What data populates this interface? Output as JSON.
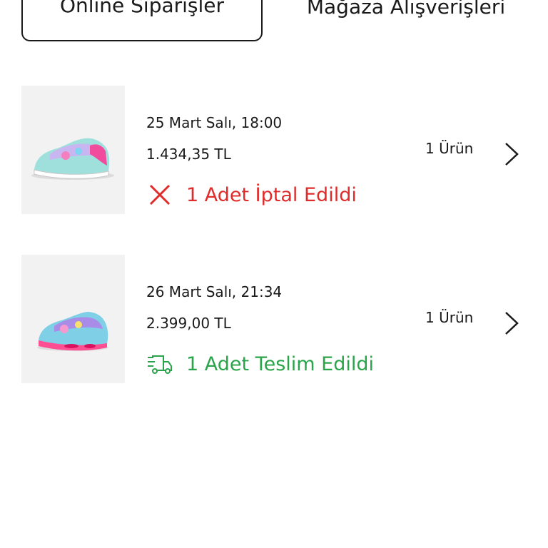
{
  "tabs": [
    {
      "label": "Online Siparişler",
      "active": true
    },
    {
      "label": "Mağaza Alışverişleri",
      "active": false
    }
  ],
  "orders": [
    {
      "date": "25 Mart Salı, 18:00",
      "price": "1.434,35 TL",
      "count": "1 Ürün",
      "status": "1 Adet İptal Edildi",
      "status_icon": "close-icon",
      "status_color": "#e02b2b"
    },
    {
      "date": "26 Mart Salı, 21:34",
      "price": "2.399,00 TL",
      "count": "1 Ürün",
      "status": "1 Adet Teslim Edildi",
      "status_icon": "delivery-truck-icon",
      "status_color": "#2aa44a"
    }
  ]
}
